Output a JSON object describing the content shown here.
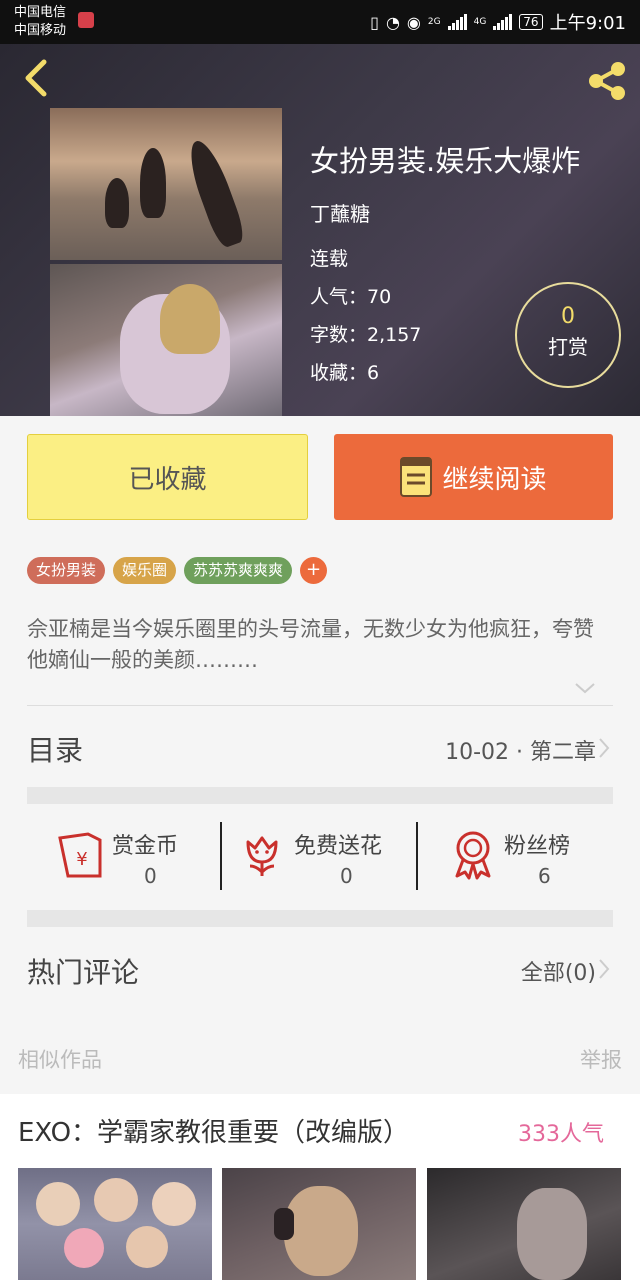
{
  "status_bar": {
    "carrier1": "中国电信",
    "carrier2": "中国移动",
    "net1": "2G",
    "net2": "4G",
    "battery": "76",
    "time": "上午9:01"
  },
  "book": {
    "title": "女扮男装.娱乐大爆炸",
    "author": "丁蘸糖",
    "status": "连载",
    "popularity": "人气：70",
    "words": "字数：2,157",
    "favorites": "收藏：6",
    "tip_count": "0",
    "tip_label": "打赏"
  },
  "actions": {
    "favorited": "已收藏",
    "continue_reading": "继续阅读"
  },
  "tags": [
    {
      "label": "女扮男装",
      "color": "#cf6d5a"
    },
    {
      "label": "娱乐圈",
      "color": "#d7a449"
    },
    {
      "label": "苏苏苏爽爽爽",
      "color": "#6fa05c"
    }
  ],
  "tag_add": "+",
  "description": "佘亚楠是当今娱乐圈里的头号流量，无数少女为他疯狂，夸赞他嫡仙一般的美颜………",
  "toc": {
    "label": "目录",
    "latest": "10-02 · 第二章"
  },
  "stats": [
    {
      "label": "赏金币",
      "value": "0",
      "icon": "red-envelope-icon"
    },
    {
      "label": "免费送花",
      "value": "0",
      "icon": "flower-icon"
    },
    {
      "label": "粉丝榜",
      "value": "6",
      "icon": "medal-icon"
    }
  ],
  "comments": {
    "label": "热门评论",
    "all": "全部(0)"
  },
  "similar": {
    "label": "相似作品",
    "report": "举报",
    "item_title": "EXO：学霸家教很重要（改编版）",
    "item_popularity": "333人气"
  },
  "colors": {
    "accent_orange": "#ec6a3c",
    "fav_yellow": "#fbef84",
    "gold": "#f3dc6a",
    "pink": "#e4689a"
  }
}
